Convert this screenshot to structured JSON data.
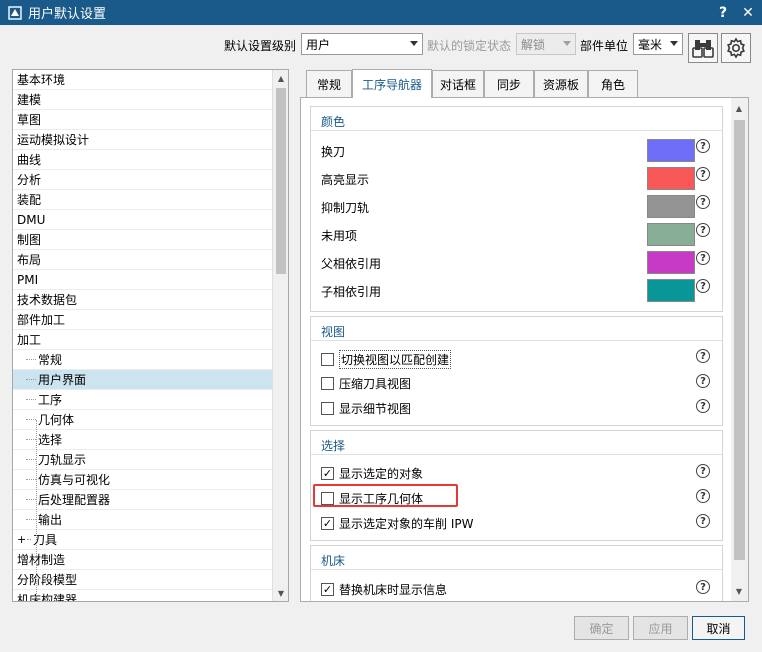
{
  "window": {
    "title": "用户默认设置",
    "help_label": "?",
    "close_label": "✕"
  },
  "toolbar": {
    "level_label": "默认设置级别",
    "level_value": "用户",
    "lock_label": "默认的锁定状态",
    "lock_value": "解锁",
    "unit_label": "部件单位",
    "unit_value": "毫米"
  },
  "tree": {
    "items": [
      {
        "label": "基本环境",
        "level": 0
      },
      {
        "label": "建模",
        "level": 0
      },
      {
        "label": "草图",
        "level": 0
      },
      {
        "label": "运动模拟设计",
        "level": 0
      },
      {
        "label": "曲线",
        "level": 0
      },
      {
        "label": "分析",
        "level": 0
      },
      {
        "label": "装配",
        "level": 0
      },
      {
        "label": "DMU",
        "level": 0
      },
      {
        "label": "制图",
        "level": 0
      },
      {
        "label": "布局",
        "level": 0
      },
      {
        "label": "PMI",
        "level": 0
      },
      {
        "label": "技术数据包",
        "level": 0
      },
      {
        "label": "部件加工",
        "level": 0
      },
      {
        "label": "加工",
        "level": 0
      },
      {
        "label": "常规",
        "level": 1
      },
      {
        "label": "用户界面",
        "level": 1,
        "selected": true
      },
      {
        "label": "工序",
        "level": 1
      },
      {
        "label": "几何体",
        "level": 1
      },
      {
        "label": "选择",
        "level": 1
      },
      {
        "label": "刀轨显示",
        "level": 1
      },
      {
        "label": "仿真与可视化",
        "level": 1
      },
      {
        "label": "后处理配置器",
        "level": 1
      },
      {
        "label": "输出",
        "level": 1
      },
      {
        "label": "刀具",
        "level": 1,
        "expander": "+"
      },
      {
        "label": "增材制造",
        "level": 0
      },
      {
        "label": "分阶段模型",
        "level": 0
      },
      {
        "label": "机床构建器",
        "level": 0
      }
    ]
  },
  "tabs": [
    {
      "label": "常规"
    },
    {
      "label": "工序导航器",
      "active": true
    },
    {
      "label": "对话框"
    },
    {
      "label": "同步"
    },
    {
      "label": "资源板"
    },
    {
      "label": "角色"
    }
  ],
  "groups": {
    "color": {
      "title": "颜色",
      "rows": [
        {
          "label": "换刀",
          "color": "#6e6ef8"
        },
        {
          "label": "高亮显示",
          "color": "#f85858"
        },
        {
          "label": "抑制刀轨",
          "color": "#949494"
        },
        {
          "label": "未用项",
          "color": "#88ae98"
        },
        {
          "label": "父相依引用",
          "color": "#c63ac6"
        },
        {
          "label": "子相依引用",
          "color": "#099698"
        }
      ]
    },
    "view": {
      "title": "视图",
      "rows": [
        {
          "label": "切换视图以匹配创建",
          "checked": false
        },
        {
          "label": "压缩刀具视图",
          "checked": false
        },
        {
          "label": "显示细节视图",
          "checked": false
        }
      ]
    },
    "select": {
      "title": "选择",
      "rows": [
        {
          "label": "显示选定的对象",
          "checked": true
        },
        {
          "label": "显示工序几何体",
          "checked": false
        },
        {
          "label": "显示选定对象的车削 IPW",
          "checked": true
        }
      ]
    },
    "machine": {
      "title": "机床",
      "rows": [
        {
          "label": "替换机床时显示信息",
          "checked": true
        }
      ]
    }
  },
  "help_glyph": "?",
  "check_glyph": "✓",
  "buttons": {
    "ok": "确定",
    "apply": "应用",
    "cancel": "取消"
  },
  "colors": {
    "titlebar": "#1a5a8a",
    "accent": "#1a5a8a",
    "highlight": "#e53935",
    "tree_selected": "#cce4ef"
  },
  "icons": {
    "app": "nx-app-icon",
    "binoculars": "binoculars-icon",
    "settings": "gear-icon"
  }
}
